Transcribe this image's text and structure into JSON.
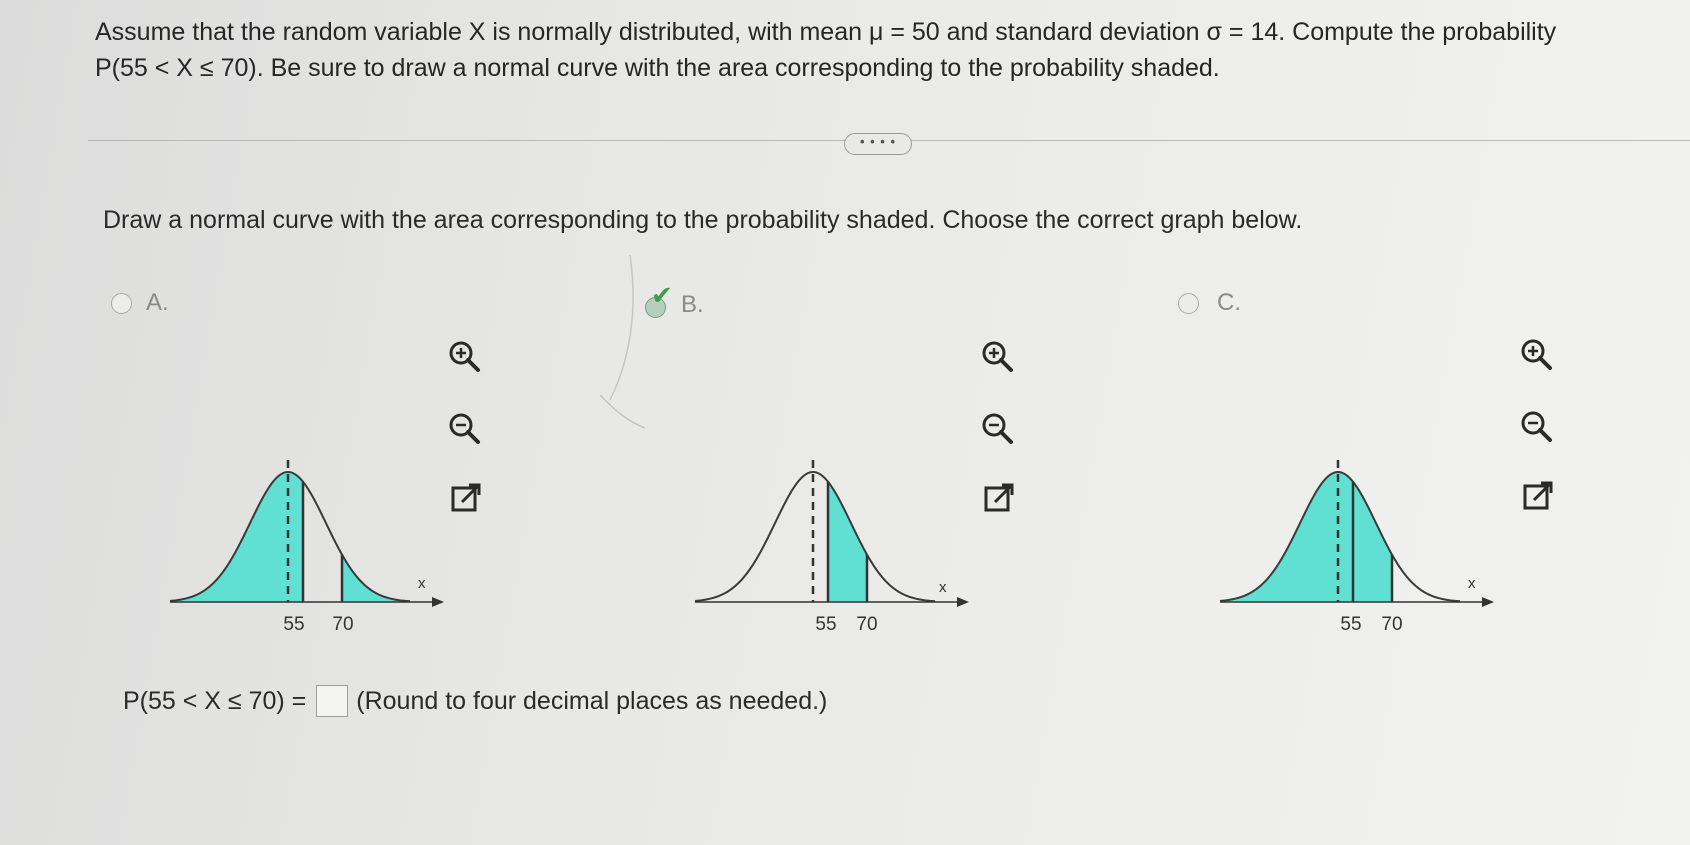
{
  "question": {
    "line1": "Assume that the random variable X is normally distributed, with mean μ = 50 and standard deviation σ = 14. Compute the probability",
    "line2": "P(55 < X ≤ 70). Be sure to draw a normal curve with the area corresponding to the probability shaded."
  },
  "more_button": "• • • •",
  "instruction": "Draw a normal curve with the area corresponding to the probability shaded. Choose the correct graph below.",
  "choices": [
    {
      "label": "A.",
      "selected": false
    },
    {
      "label": "B.",
      "selected": true
    },
    {
      "label": "C.",
      "selected": false
    }
  ],
  "selected_check": "✔",
  "graphs": {
    "axis_var": "x",
    "tick_a": "55",
    "tick_b": "70"
  },
  "answer": {
    "prefix": "P(55 < X ≤ 70) =",
    "suffix": "(Round to four decimal places as needed.)"
  },
  "colors": {
    "shade": "#5fe0d2",
    "curve": "#3a3a3a"
  },
  "icons": [
    "zoom-in-icon",
    "zoom-out-icon",
    "pop-out-icon",
    "check-icon",
    "radio-icon"
  ]
}
